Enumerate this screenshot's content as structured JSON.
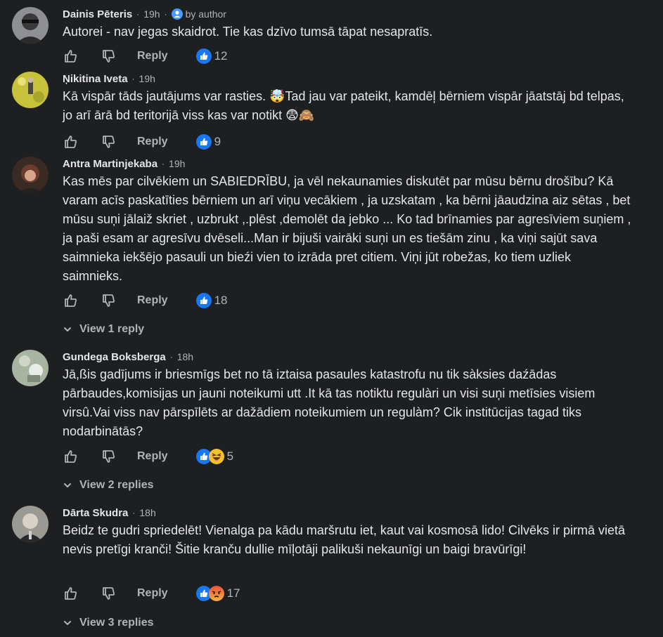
{
  "comments": [
    {
      "author": "Dainis Pēteris",
      "time": "19h",
      "badge": "by author",
      "text": "Autorei - nav jegas skaidrot. Tie kas dzīvo tumsā tāpat nesapratīs.",
      "reply_label": "Reply",
      "reactions": [
        "like-icon"
      ],
      "count": "12"
    },
    {
      "author": "Ņikitina Iveta",
      "time": "19h",
      "text": "Kā vispār tāds jautājums var rasties. 🤯Tad jau var pateikt, kamdēļ bērniem vispār jāatstāj bd telpas, jo arī ārā bd teritorijā viss kas var notikt 😨🙈",
      "reply_label": "Reply",
      "reactions": [
        "like-icon"
      ],
      "count": "9"
    },
    {
      "author": "Antra Martinjekaba",
      "time": "19h",
      "text": "Kas mēs par cilvēkiem un SABIEDRĪBU, ja vēl nekaunamies diskutēt par mūsu bērnu drošību? Kā varam acīs paskatīties bērniem un arī viņu vecākiem , ja uzskatam , ka bērni jāaudzina aiz sētas , bet mūsu suņi jālaiž skriet , uzbrukt ,.plēst ,demolēt da jebko ... Ko tad brīnamies par agresīviem suņiem , ja paši esam ar agresīvu dvēseli...Man ir bijuši vairāki suņi un es tiešām zinu , ka viņi sajūt sava saimnieka iekšējo pasauli un bieźi vien to izrāda pret citiem. Viņi jūt robežas, ko tiem uzliek saimnieks.",
      "reply_label": "Reply",
      "reactions": [
        "like-icon"
      ],
      "count": "18",
      "view_replies": "View 1 reply"
    },
    {
      "author": "Gundega Boksberga",
      "time": "18h",
      "text": "Jā,ßis gadījums ir briesmīgs bet no tā iztaisa pasaules katastrofu nu tik sàksies daźādas pārbaudes,komisijas un jauni noteikumi utt .It kā tas notiktu regulàri un visi suņi metīsies visiem virsû.Vai viss nav pārspīlēts ar dažādiem noteikumiem un regulàm? Cik institūcijas tagad tiks nodarbinātās?",
      "reply_label": "Reply",
      "reactions": [
        "like-icon",
        "haha-icon"
      ],
      "count": "5",
      "view_replies": "View 2 replies"
    },
    {
      "author": "Dārta Skudra",
      "time": "18h",
      "text": "Beidz te gudri spriedelēt! Vienalga pa kādu maršrutu iet, kaut vai kosmosā lido! Cilvēks ir pirmā vietā nevis pretīgi kranči! Šitie kranču dullie mīļotāji palikuši nekaunīgi un baigi bravūrīgi!",
      "reply_label": "Reply",
      "reactions": [
        "like-icon",
        "angry-icon"
      ],
      "count": "17",
      "view_replies": "View 3 replies"
    }
  ],
  "colors": {
    "background": "#1e1f20",
    "text": "#e4e6eb",
    "secondary": "#b0b3b8",
    "like_blue": "#1877f2",
    "angry_red": "#e9503d",
    "haha_yellow": "#f7c02e"
  }
}
